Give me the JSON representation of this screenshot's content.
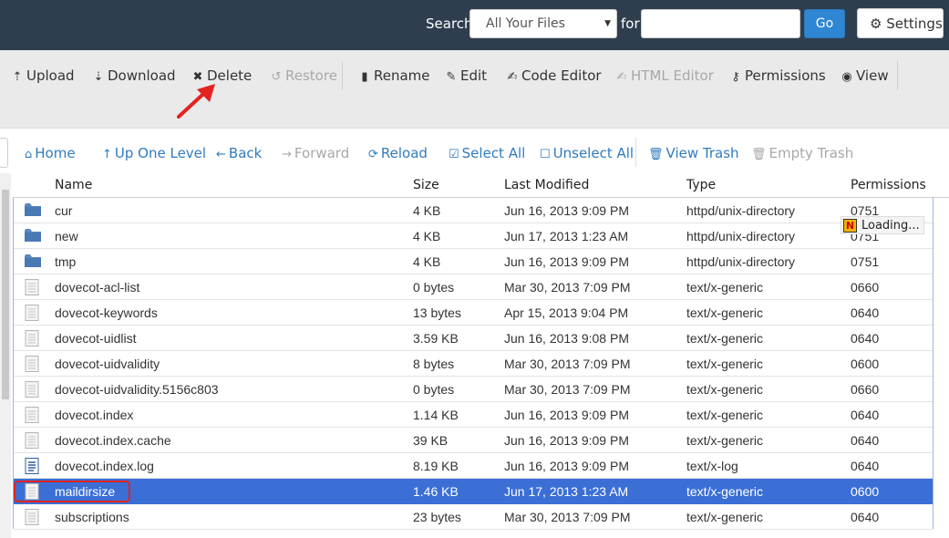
{
  "header": {
    "search_label": "Search",
    "search_scope": "All Your Files",
    "for_label": "for",
    "search_value": "",
    "go_label": "Go",
    "settings_label": "Settings"
  },
  "toolbar": {
    "upload": "Upload",
    "download": "Download",
    "delete": "Delete",
    "restore": "Restore",
    "rename": "Rename",
    "edit": "Edit",
    "code_editor": "Code Editor",
    "html_editor": "HTML Editor",
    "permissions": "Permissions",
    "view": "View"
  },
  "nav": {
    "home": "Home",
    "up_one_level": "Up One Level",
    "back": "Back",
    "forward": "Forward",
    "reload": "Reload",
    "select_all": "Select All",
    "unselect_all": "Unselect All",
    "view_trash": "View Trash",
    "empty_trash": "Empty Trash"
  },
  "table": {
    "columns": [
      "Name",
      "Size",
      "Last Modified",
      "Type",
      "Permissions"
    ],
    "rows": [
      {
        "icon": "folder-icon",
        "name": "cur",
        "size": "4 KB",
        "modified": "Jun 16, 2013 9:09 PM",
        "type": "httpd/unix-directory",
        "perms": "0751"
      },
      {
        "icon": "folder-icon",
        "name": "new",
        "size": "4 KB",
        "modified": "Jun 17, 2013 1:23 AM",
        "type": "httpd/unix-directory",
        "perms": "0751"
      },
      {
        "icon": "folder-icon",
        "name": "tmp",
        "size": "4 KB",
        "modified": "Jun 16, 2013 9:09 PM",
        "type": "httpd/unix-directory",
        "perms": "0751"
      },
      {
        "icon": "file-icon",
        "name": "dovecot-acl-list",
        "size": "0 bytes",
        "modified": "Mar 30, 2013 7:09 PM",
        "type": "text/x-generic",
        "perms": "0660"
      },
      {
        "icon": "file-icon",
        "name": "dovecot-keywords",
        "size": "13 bytes",
        "modified": "Apr 15, 2013 9:04 PM",
        "type": "text/x-generic",
        "perms": "0640"
      },
      {
        "icon": "file-icon",
        "name": "dovecot-uidlist",
        "size": "3.59 KB",
        "modified": "Jun 16, 2013 9:08 PM",
        "type": "text/x-generic",
        "perms": "0640"
      },
      {
        "icon": "file-icon",
        "name": "dovecot-uidvalidity",
        "size": "8 bytes",
        "modified": "Mar 30, 2013 7:09 PM",
        "type": "text/x-generic",
        "perms": "0600"
      },
      {
        "icon": "file-icon",
        "name": "dovecot-uidvalidity.5156c803",
        "size": "0 bytes",
        "modified": "Mar 30, 2013 7:09 PM",
        "type": "text/x-generic",
        "perms": "0660"
      },
      {
        "icon": "file-icon",
        "name": "dovecot.index",
        "size": "1.14 KB",
        "modified": "Jun 16, 2013 9:09 PM",
        "type": "text/x-generic",
        "perms": "0640"
      },
      {
        "icon": "file-icon",
        "name": "dovecot.index.cache",
        "size": "39 KB",
        "modified": "Jun 16, 2013 9:09 PM",
        "type": "text/x-generic",
        "perms": "0640"
      },
      {
        "icon": "log-file-icon",
        "name": "dovecot.index.log",
        "size": "8.19 KB",
        "modified": "Jun 16, 2013 9:09 PM",
        "type": "text/x-log",
        "perms": "0640"
      },
      {
        "icon": "file-icon",
        "name": "maildirsize",
        "size": "1.46 KB",
        "modified": "Jun 17, 2013 1:23 AM",
        "type": "text/x-generic",
        "perms": "0600",
        "selected": true
      },
      {
        "icon": "file-icon",
        "name": "subscriptions",
        "size": "23 bytes",
        "modified": "Mar 30, 2013 7:09 PM",
        "type": "text/x-generic",
        "perms": "0640"
      }
    ]
  },
  "loading_label": "Loading...",
  "loading_badge": "N",
  "colors": {
    "header_bg": "#2f3e4e",
    "toolbar_bg": "#eaeaea",
    "link": "#2f7bbf",
    "selected_row": "#3b6fd6",
    "highlight_box": "#e3231f"
  }
}
